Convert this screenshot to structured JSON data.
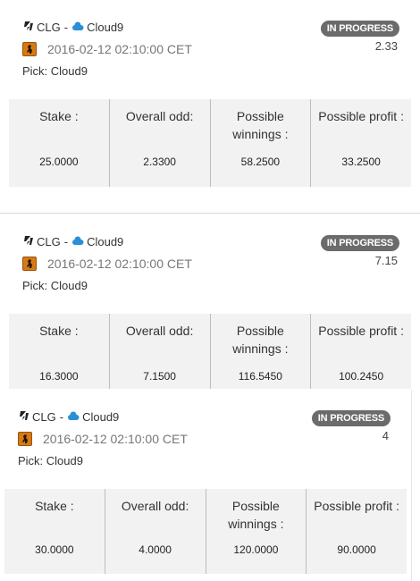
{
  "bets": [
    {
      "team_a": "CLG",
      "separator": "-",
      "team_b": "Cloud9",
      "date": "2016-02-12 02:10:00 CET",
      "pick": "Pick: Cloud9",
      "status": "IN PROGRESS",
      "odd": "2.33",
      "stake_label": "Stake :",
      "odd_label": "Overall odd:",
      "winnings_label": "Possible winnings :",
      "profit_label": "Possible profit :",
      "stake": "25.0000",
      "overall_odd": "2.3300",
      "winnings": "58.2500",
      "profit": "33.2500"
    },
    {
      "team_a": "CLG",
      "separator": "-",
      "team_b": "Cloud9",
      "date": "2016-02-12 02:10:00 CET",
      "pick": "Pick: Cloud9",
      "status": "IN PROGRESS",
      "odd": "7.15",
      "stake_label": "Stake :",
      "odd_label": "Overall odd:",
      "winnings_label": "Possible winnings :",
      "profit_label": "Possible profit :",
      "stake": "16.3000",
      "overall_odd": "7.1500",
      "winnings": "116.5450",
      "profit": "100.2450"
    },
    {
      "team_a": "CLG",
      "separator": "-",
      "team_b": "Cloud9",
      "date": "2016-02-12 02:10:00 CET",
      "pick": "Pick: Cloud9",
      "status": "IN PROGRESS",
      "odd": "4",
      "stake_label": "Stake :",
      "odd_label": "Overall odd:",
      "winnings_label": "Possible winnings :",
      "profit_label": "Possible profit :",
      "stake": "30.0000",
      "overall_odd": "4.0000",
      "winnings": "120.0000",
      "profit": "90.0000"
    }
  ],
  "colors": {
    "badge": "#6b6b6b",
    "game_icon": "#d47a16",
    "cloud9_blue": "#2b8fd6",
    "stats_bg": "#f2f2f2"
  },
  "icons": {
    "team_a_logo": "clg-logo-icon",
    "team_b_logo": "cloud9-logo-icon",
    "game": "counter-strike-game-icon"
  }
}
